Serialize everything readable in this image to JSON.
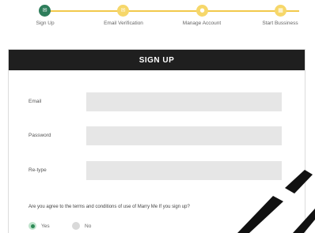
{
  "stepper": {
    "steps": [
      {
        "label": "Sign Up",
        "state": "done"
      },
      {
        "label": "Email Verification",
        "state": "pending"
      },
      {
        "label": "Manage Account",
        "state": "pending"
      },
      {
        "label": "Start Bussiness",
        "state": "pending"
      }
    ]
  },
  "form": {
    "title": "SIGN UP",
    "fields": [
      {
        "label": "Email",
        "value": ""
      },
      {
        "label": "Password",
        "value": ""
      },
      {
        "label": "Re-type",
        "value": ""
      }
    ],
    "question": "Are you agree to the terms and conditions of use of Marry Me If you sign up?",
    "options": [
      {
        "label": "Yes",
        "selected": true
      },
      {
        "label": "No",
        "selected": false
      }
    ]
  },
  "colors": {
    "done": "#2e7d5b",
    "pending": "#f6d76a",
    "header": "#1f1f1f",
    "field": "#e6e6e6"
  }
}
